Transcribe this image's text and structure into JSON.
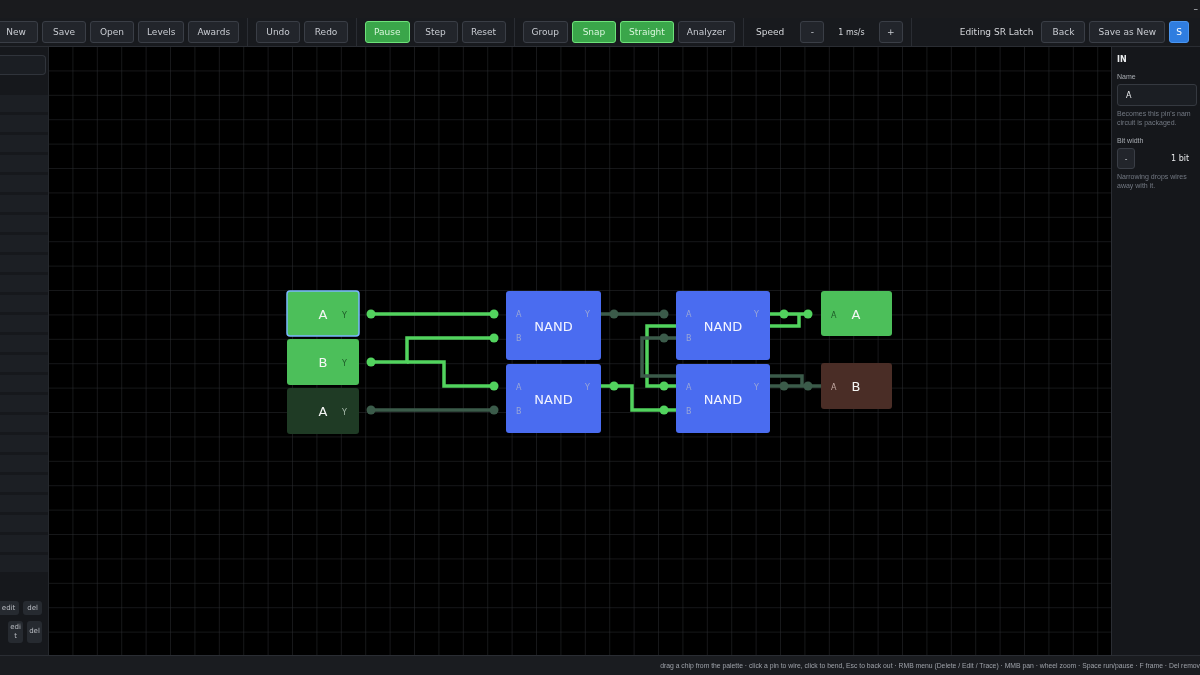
{
  "window": {
    "control": "–"
  },
  "toolbar": {
    "groups": [
      {
        "items": [
          {
            "kind": "button",
            "label": "New",
            "on": false
          },
          {
            "kind": "button",
            "label": "Save",
            "on": false
          },
          {
            "kind": "button",
            "label": "Open",
            "on": false
          },
          {
            "kind": "button",
            "label": "Levels",
            "on": false
          },
          {
            "kind": "button",
            "label": "Awards",
            "on": false
          }
        ]
      },
      {
        "items": [
          {
            "kind": "button",
            "label": "Undo",
            "on": false
          },
          {
            "kind": "button",
            "label": "Redo",
            "on": false
          }
        ]
      },
      {
        "items": [
          {
            "kind": "button",
            "label": "Pause",
            "on": true
          },
          {
            "kind": "button",
            "label": "Step",
            "on": false
          },
          {
            "kind": "button",
            "label": "Reset",
            "on": false
          }
        ]
      },
      {
        "items": [
          {
            "kind": "button",
            "label": "Group",
            "on": false
          },
          {
            "kind": "button",
            "label": "Snap",
            "on": true
          },
          {
            "kind": "button",
            "label": "Straight",
            "on": true
          },
          {
            "kind": "button",
            "label": "Analyzer",
            "on": false
          }
        ]
      },
      {
        "items": [
          {
            "kind": "text",
            "label": "Speed"
          },
          {
            "kind": "button",
            "label": "-",
            "on": false
          },
          {
            "kind": "reading",
            "label": "1 ms/s"
          },
          {
            "kind": "button",
            "label": "+",
            "on": false
          }
        ]
      },
      {
        "items": [
          {
            "kind": "text",
            "label": "Editing SR Latch"
          },
          {
            "kind": "button",
            "label": "Back",
            "on": false
          },
          {
            "kind": "button",
            "label": "Save as New",
            "on": false
          },
          {
            "kind": "primary",
            "label": "S"
          }
        ]
      }
    ]
  },
  "palette_actions": [
    {
      "kind": "wide",
      "buttons": [
        "edit",
        "del"
      ]
    },
    {
      "kind": "narrow",
      "buttons": [
        "edit",
        "del"
      ]
    }
  ],
  "canvas": {
    "chips": [
      {
        "kind": "input",
        "label": "A",
        "pin": "Y",
        "on": true,
        "selected": true
      },
      {
        "kind": "input",
        "label": "B",
        "pin": "Y",
        "on": true,
        "selected": false
      },
      {
        "kind": "input",
        "label": "A",
        "pin": "Y",
        "on": false,
        "selected": false
      },
      {
        "kind": "nand",
        "label": "NAND",
        "pins": [
          "A",
          "B",
          "Y"
        ],
        "selected": false
      },
      {
        "kind": "nand",
        "label": "NAND",
        "pins": [
          "A",
          "B",
          "Y"
        ],
        "selected": false
      },
      {
        "kind": "nand",
        "label": "NAND",
        "pins": [
          "A",
          "B",
          "Y"
        ],
        "selected": false
      },
      {
        "kind": "nand",
        "label": "NAND",
        "pins": [
          "A",
          "B",
          "Y"
        ],
        "selected": false
      },
      {
        "kind": "output",
        "label": "A",
        "pin": "A",
        "on": true,
        "selected": false
      },
      {
        "kind": "output",
        "label": "B",
        "pin": "A",
        "on": false,
        "selected": false
      }
    ],
    "wires": [
      {
        "on": true
      },
      {
        "on": true
      },
      {
        "on": true
      },
      {
        "on": false
      },
      {
        "on": false
      },
      {
        "on": true
      },
      {
        "on": true
      },
      {
        "on": true
      },
      {
        "on": false
      },
      {
        "on": false
      }
    ]
  },
  "inspector": {
    "title": "IN",
    "name_label": "Name",
    "name_value": "A",
    "name_hint": [
      "Becomes this pin's nam",
      "circuit is packaged."
    ],
    "width_label": "Bit width",
    "width_button": "-",
    "width_value": "1 bit",
    "width_hint": [
      "Narrowing drops wires",
      "away with it."
    ]
  },
  "status_bar": "drag a chip from the palette · click a pin to wire, click to bend, Esc to back out · RMB menu (Delete / Edit / Trace) · MMB pan · wheel zoom · Space run/pause · F frame · Del remov"
}
